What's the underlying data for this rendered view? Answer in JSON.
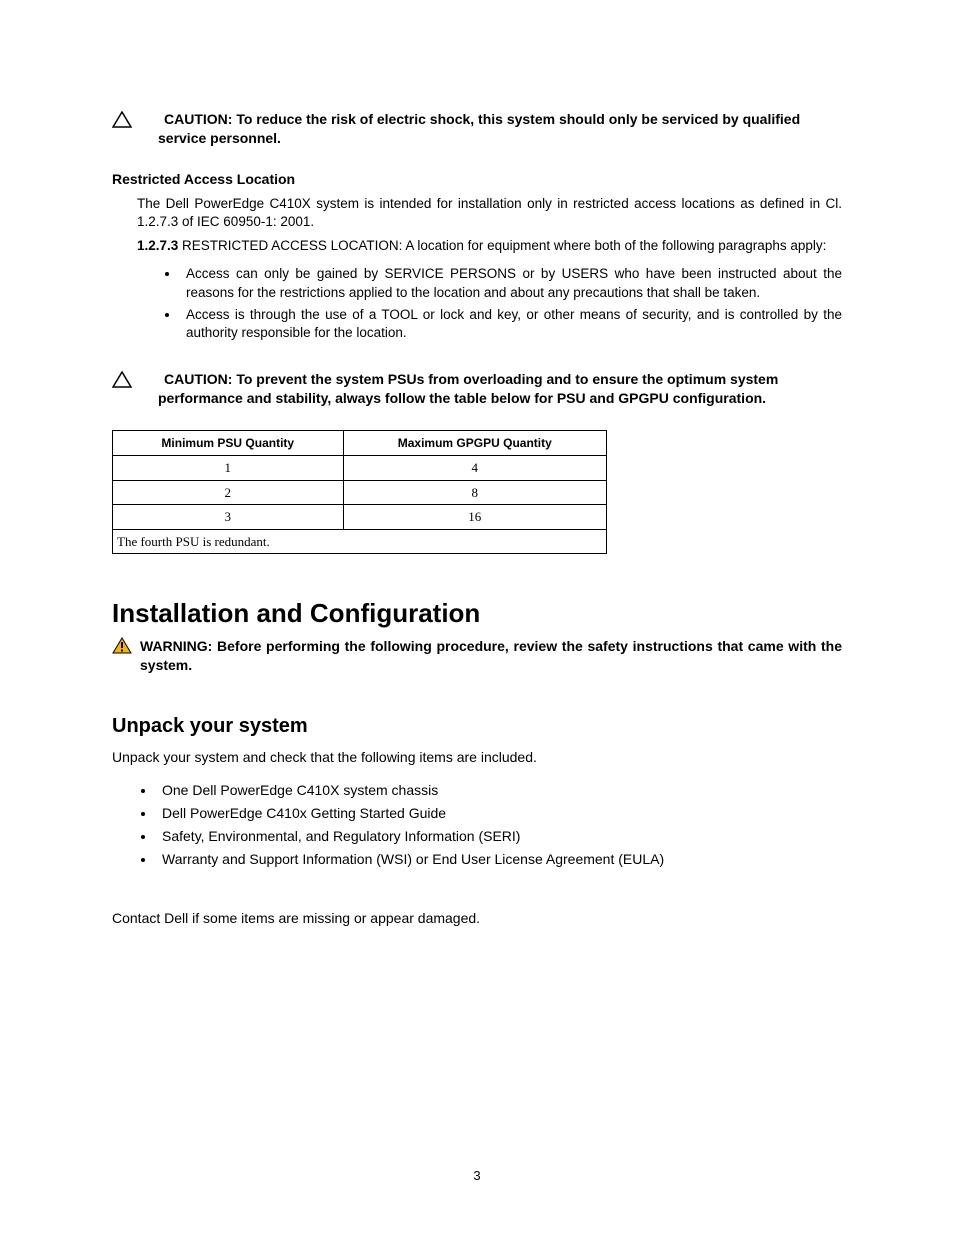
{
  "caution1": {
    "label": "CAUTION:",
    "text": " To reduce the risk of electric shock, this system should only be serviced by qualified service personnel."
  },
  "restricted": {
    "heading": "Restricted Access Location",
    "para1": "The Dell PowerEdge C410X system is intended for installation only in restricted access locations as defined in Cl. 1.2.7.3 of IEC 60950-1: 2001.",
    "para2_bold": "1.2.7.3",
    "para2_rest": " RESTRICTED ACCESS LOCATION: A location for equipment where both of the following paragraphs apply:",
    "bullets": [
      "Access can only be gained by SERVICE PERSONS or by USERS who have been instructed about the reasons for the restrictions applied to the location and about any precautions that shall be taken.",
      "Access is through the use of a TOOL or lock and key, or other means of security, and is controlled by the authority responsible for the location."
    ]
  },
  "caution2": {
    "label": "CAUTION:",
    "text": " To prevent the system PSUs from overloading and to ensure the optimum system performance and stability, always follow the table below for PSU and GPGPU configuration."
  },
  "table": {
    "header": [
      "Minimum PSU Quantity",
      "Maximum GPGPU Quantity"
    ],
    "rows": [
      [
        "1",
        "4"
      ],
      [
        "2",
        "8"
      ],
      [
        "3",
        "16"
      ]
    ],
    "note": "The fourth PSU is redundant."
  },
  "h1": "Installation and Configuration",
  "warning": {
    "label": "WARNING:",
    "text": " Before performing the following procedure, review the safety instructions that came with the system."
  },
  "h2": "Unpack your system",
  "unpack_intro": "Unpack your system and check that the following items are included.",
  "items": [
    "One Dell PowerEdge C410X system chassis",
    "Dell PowerEdge C410x Getting Started Guide",
    "Safety, Environmental, and Regulatory Information (SERI)",
    "Warranty and Support Information (WSI) or End User License Agreement (EULA)"
  ],
  "contact": "Contact Dell if some items are missing or appear damaged.",
  "page": "3"
}
